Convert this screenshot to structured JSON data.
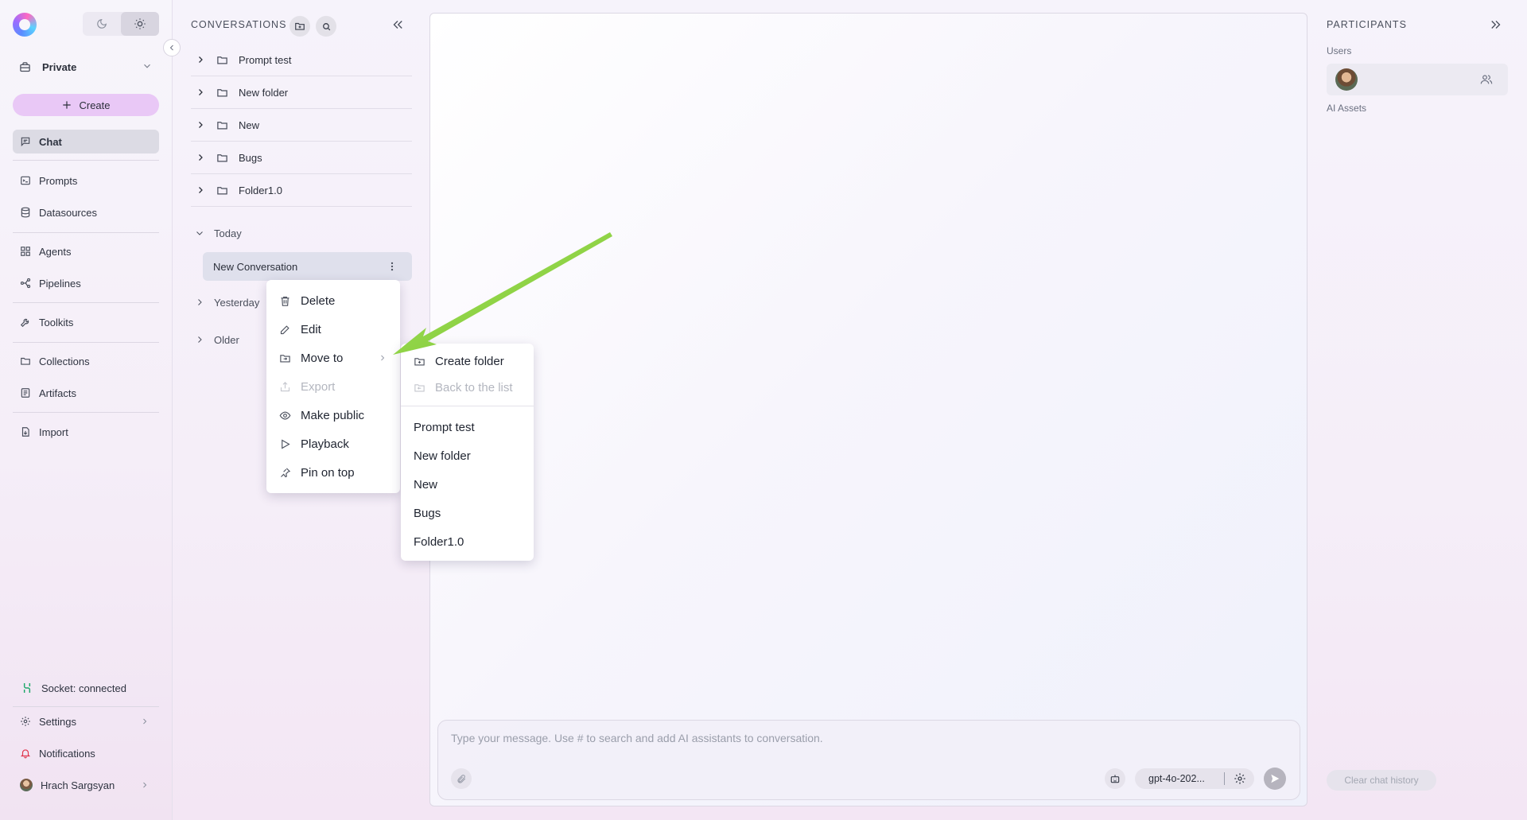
{
  "nav": {
    "project": "Private",
    "create_label": "Create",
    "items": [
      {
        "label": "Chat",
        "icon": "chat-icon"
      },
      {
        "label": "Prompts",
        "icon": "prompt-icon"
      },
      {
        "label": "Datasources",
        "icon": "database-icon"
      },
      {
        "label": "Agents",
        "icon": "grid-icon"
      },
      {
        "label": "Pipelines",
        "icon": "pipeline-icon"
      },
      {
        "label": "Toolkits",
        "icon": "wrench-icon"
      },
      {
        "label": "Collections",
        "icon": "folder-icon"
      },
      {
        "label": "Artifacts",
        "icon": "artifact-icon"
      },
      {
        "label": "Import",
        "icon": "import-icon"
      }
    ],
    "socket_status": "Socket: connected",
    "settings": "Settings",
    "notifications": "Notifications",
    "user_name": "Hrach Sargsyan"
  },
  "conversations": {
    "title": "CONVERSATIONS",
    "folders": [
      "Prompt test",
      "New folder",
      "New",
      "Bugs",
      "Folder1.0"
    ],
    "groups": {
      "today": "Today",
      "yesterday": "Yesterday",
      "older": "Older"
    },
    "active_conversation": "New Conversation"
  },
  "context_menu": {
    "items": [
      "Delete",
      "Edit",
      "Move to",
      "Export",
      "Make public",
      "Playback",
      "Pin on top"
    ],
    "disabled": [
      "Export"
    ]
  },
  "move_submenu": {
    "create_folder": "Create folder",
    "back_to_list": "Back to the list",
    "folders": [
      "Prompt test",
      "New folder",
      "New",
      "Bugs",
      "Folder1.0"
    ]
  },
  "chat": {
    "input_placeholder": "Type your message. Use # to search and add AI assistants to conversation.",
    "model": "gpt-4o-202..."
  },
  "participants": {
    "title": "PARTICIPANTS",
    "users_label": "Users",
    "ai_assets_label": "AI Assets",
    "clear_history": "Clear chat history"
  },
  "colors": {
    "accent_create": "#e9c8f6",
    "socket_green": "#1fa86b",
    "notification_red": "#e0344b",
    "arrow_green": "#8dd13f"
  }
}
